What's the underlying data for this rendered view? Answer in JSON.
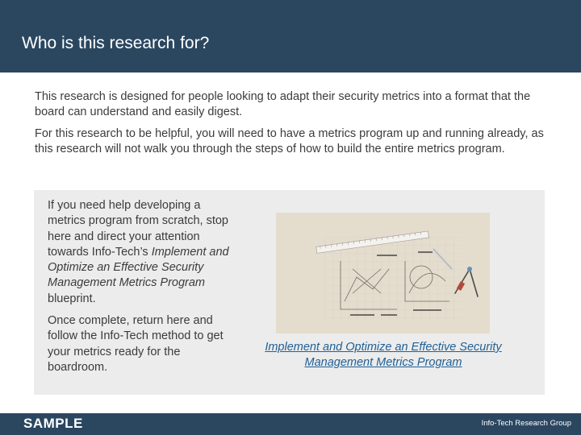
{
  "header": {
    "title": "Who is this research for?"
  },
  "intro": {
    "paragraph1": "This research is designed for people looking to adapt their security metrics into a format that the board can understand and easily digest.",
    "paragraph2": "For this research to be helpful, you will need to have a metrics program up and running already, as this research will not walk you through the steps of how to build the entire metrics program."
  },
  "callout": {
    "text_before": "If you need help developing a metrics program from scratch, stop here and direct your attention towards Info-Tech’s ",
    "blueprint_name_italic": "Implement and Optimize an Effective Security Management Metrics Program",
    "text_after": " blueprint.",
    "paragraph2": "Once complete, return here and follow the Info-Tech method to get your metrics ready for the boardroom.",
    "link_label": "Implement and Optimize an Effective Security Management Metrics Program"
  },
  "footer": {
    "sample_label": "SAMPLE",
    "brand": "Info-Tech Research Group"
  },
  "colors": {
    "header_bg": "#2b4760",
    "callout_bg": "#ececec",
    "link": "#1f5f96",
    "body_text": "#3b3b3b"
  }
}
